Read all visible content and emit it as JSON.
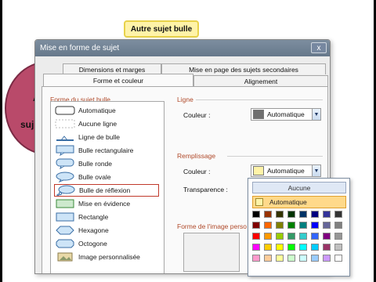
{
  "canvas": {
    "topic": "Autre sujet bulle",
    "central_fragments": [
      "A",
      "suj"
    ]
  },
  "dialog": {
    "title": "Mise en forme de sujet",
    "close_glyph": "x",
    "tabs_back": [
      "Dimensions et marges",
      "Mise en page des sujets secondaires"
    ],
    "tabs_front": [
      "Forme et couleur",
      "Alignement"
    ],
    "active_tab": "Forme et couleur",
    "shape_section": "Forme du sujet bulle",
    "shapes": [
      {
        "label": "Automatique",
        "icon": "rounded-rect-icon"
      },
      {
        "label": "Aucune ligne",
        "icon": "no-line-icon"
      },
      {
        "label": "Ligne de bulle",
        "icon": "line-icon"
      },
      {
        "label": "Bulle rectangulaire",
        "icon": "rect-bubble-icon"
      },
      {
        "label": "Bulle ronde",
        "icon": "round-bubble-icon"
      },
      {
        "label": "Bulle ovale",
        "icon": "oval-bubble-icon"
      },
      {
        "label": "Bulle de réflexion",
        "icon": "thought-bubble-icon"
      },
      {
        "label": "Mise en évidence",
        "icon": "highlight-icon"
      },
      {
        "label": "Rectangle",
        "icon": "rectangle-icon"
      },
      {
        "label": "Hexagone",
        "icon": "hexagon-icon"
      },
      {
        "label": "Octogone",
        "icon": "octagon-icon"
      },
      {
        "label": "Image personnalisée",
        "icon": "custom-image-icon"
      }
    ],
    "selected_shape": "Bulle de réflexion",
    "line_section": "Ligne",
    "line_color_label": "Couleur :",
    "line_color_value": "Automatique",
    "line_color_swatch": "#707070",
    "fill_section": "Remplissage",
    "fill_color_label": "Couleur :",
    "fill_color_value": "Automatique",
    "fill_color_swatch": "#fff3a8",
    "transparency_label": "Transparence :",
    "image_section": "Forme de l'image perso"
  },
  "palette": {
    "none_label": "Aucune",
    "auto_label": "Automatique",
    "rows": [
      [
        "#000000",
        "#993300",
        "#333300",
        "#003300",
        "#003366",
        "#000080",
        "#333399",
        "#333333"
      ],
      [
        "#800000",
        "#ff6600",
        "#808000",
        "#008000",
        "#008080",
        "#0000ff",
        "#666699",
        "#808080"
      ],
      [
        "#ff0000",
        "#ff9900",
        "#99cc00",
        "#339966",
        "#33cccc",
        "#3366ff",
        "#800080",
        "#969696"
      ],
      [
        "#ff00ff",
        "#ffcc00",
        "#ffff00",
        "#00ff00",
        "#00ffff",
        "#00ccff",
        "#993366",
        "#c0c0c0"
      ],
      [
        "#ff99cc",
        "#ffcc99",
        "#ffff99",
        "#ccffcc",
        "#ccffff",
        "#99ccff",
        "#cc99ff",
        "#ffffff"
      ]
    ]
  }
}
